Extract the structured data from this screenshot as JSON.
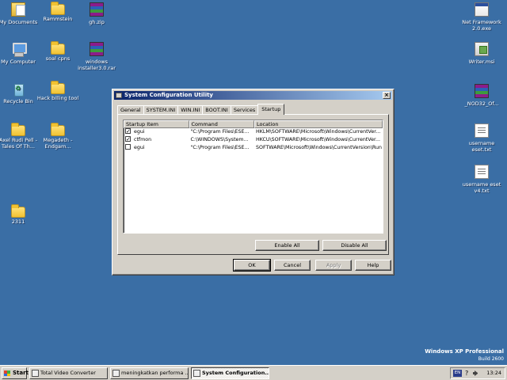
{
  "desktop": {
    "icons": [
      {
        "label": "My Documents",
        "icon": "my-documents-icon"
      },
      {
        "label": "Rammstein",
        "icon": "folder-icon"
      },
      {
        "label": "gh.zip",
        "icon": "winrar-archive-icon"
      },
      {
        "label": "My Computer",
        "icon": "my-computer-icon"
      },
      {
        "label": "soal cpns",
        "icon": "folder-icon"
      },
      {
        "label": "windows installer3.0.rar",
        "icon": "winrar-archive-icon"
      },
      {
        "label": "Recycle Bin",
        "icon": "recycle-bin-icon"
      },
      {
        "label": "Hack billing tool",
        "icon": "folder-icon"
      },
      {
        "label": "Axel Rudi Pell - Tales Of Th...",
        "icon": "folder-icon"
      },
      {
        "label": "Megadeth - Endgam...",
        "icon": "folder-icon"
      },
      {
        "label": "2311",
        "icon": "folder-icon"
      },
      {
        "label": "Net Framework 2.0.exe",
        "icon": "exe-icon"
      },
      {
        "label": "Writer.msi",
        "icon": "msi-icon"
      },
      {
        "label": "_NOD32_Of...",
        "icon": "winrar-archive-icon"
      },
      {
        "label": "username eset.txt",
        "icon": "text-file-icon"
      },
      {
        "label": "username eset v4.txt",
        "icon": "text-file-icon"
      }
    ]
  },
  "window": {
    "title": "System Configuration Utility",
    "close_glyph": "×",
    "tabs": [
      "General",
      "SYSTEM.INI",
      "WIN.INI",
      "BOOT.INI",
      "Services",
      "Startup"
    ],
    "active_tab": "Startup",
    "columns": [
      "Startup Item",
      "Command",
      "Location"
    ],
    "rows": [
      {
        "checked": true,
        "item": "egui",
        "command": "\"C:\\Program Files\\ESE...",
        "location": "HKLM\\SOFTWARE\\Microsoft\\Windows\\CurrentVer..."
      },
      {
        "checked": true,
        "item": "ctfmon",
        "command": "C:\\WINDOWS\\System...",
        "location": "HKCU\\SOFTWARE\\Microsoft\\Windows\\CurrentVer..."
      },
      {
        "checked": false,
        "item": "egui",
        "command": "\"C:\\Program Files\\ESE...",
        "location": "SOFTWARE\\Microsoft\\Windows\\CurrentVersion\\Run"
      }
    ],
    "enable_all_label": "Enable All",
    "disable_all_label": "Disable All",
    "ok_label": "OK",
    "cancel_label": "Cancel",
    "apply_label": "Apply",
    "help_label": "Help"
  },
  "watermark": {
    "line1": "Windows XP Professional",
    "line2": "Build 2600"
  },
  "taskbar": {
    "start_label": "Start",
    "tasks": [
      {
        "label": "Total Video Converter",
        "active": false
      },
      {
        "label": "meningkatkan performa ...",
        "active": false
      },
      {
        "label": "System Configuration...",
        "active": true
      }
    ],
    "tray": {
      "language": "EN",
      "help_glyph": "?",
      "clock": "13:24"
    }
  },
  "colors": {
    "desktop_bg": "#3a6ea5",
    "titlebar_start": "#0a246a",
    "titlebar_end": "#a6caf0",
    "face": "#d4d0c8"
  }
}
